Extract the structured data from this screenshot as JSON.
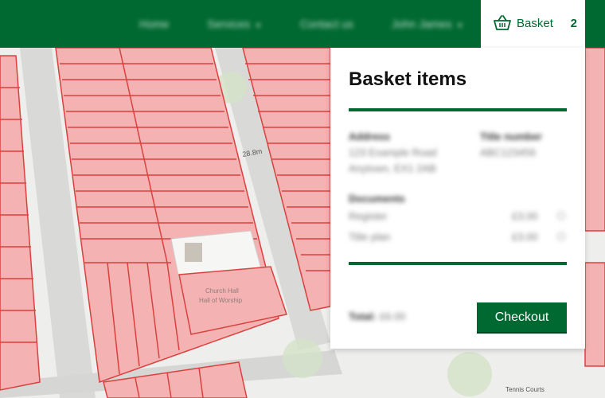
{
  "nav": {
    "items": [
      {
        "label": "Home",
        "has_caret": false
      },
      {
        "label": "Services",
        "has_caret": true
      },
      {
        "label": "Contact us",
        "has_caret": false
      },
      {
        "label": "John James",
        "has_caret": true
      }
    ],
    "basket_label": "Basket",
    "basket_count": "2",
    "basket_icon": "basket-icon"
  },
  "panel": {
    "title": "Basket items",
    "address_label": "Address",
    "address_line1": "123 Example Road",
    "address_line2": "Anytown, EX1 2AB",
    "title_number_label": "Title number",
    "title_number_value": "ABC123456",
    "documents_label": "Documents",
    "documents": [
      {
        "name": "Register",
        "price": "£3.00"
      },
      {
        "name": "Title plan",
        "price": "£3.00"
      }
    ],
    "total_label": "Total:",
    "total_value": "£6.00",
    "checkout_label": "Checkout"
  },
  "map": {
    "road_label": "28.8m",
    "building_label_1": "Church Hall",
    "building_label_2": "Hall of Worship",
    "court_label": "Tennis Courts"
  },
  "colors": {
    "brand": "#006931",
    "parcel_fill": "#f4b2b2",
    "parcel_stroke": "#d9413f",
    "road": "#d8d8d6"
  }
}
